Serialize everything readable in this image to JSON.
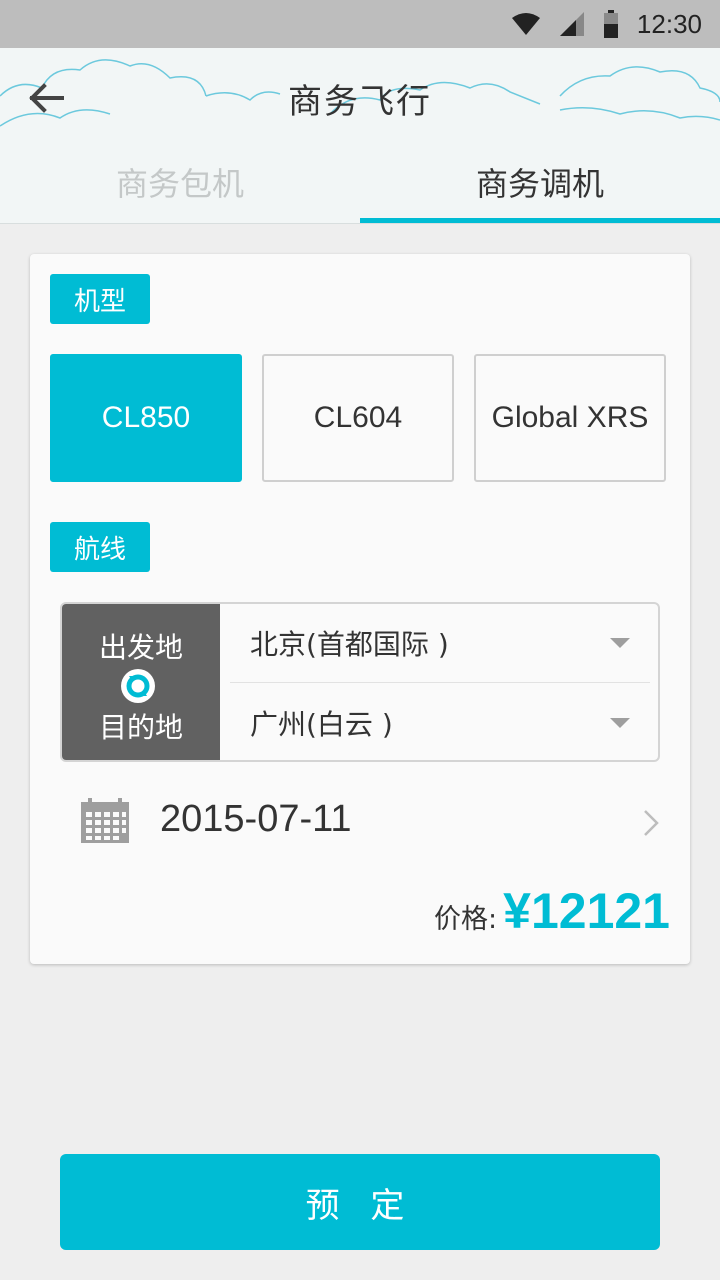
{
  "status_bar": {
    "time": "12:30"
  },
  "header": {
    "title": "商务飞行",
    "tabs": [
      {
        "label": "商务包机",
        "active": false
      },
      {
        "label": "商务调机",
        "active": true
      }
    ]
  },
  "aircraft": {
    "section_label": "机型",
    "options": [
      {
        "label": "CL850",
        "selected": true
      },
      {
        "label": "CL604",
        "selected": false
      },
      {
        "label": "Global XRS",
        "selected": false
      }
    ]
  },
  "route": {
    "section_label": "航线",
    "from_label": "出发地",
    "to_label": "目的地",
    "from_value": "北京(首都国际 )",
    "to_value": "广州(白云 )"
  },
  "date": {
    "value": "2015-07-11"
  },
  "price": {
    "label": "价格:",
    "value": "¥12121"
  },
  "book_button": {
    "label": "预 定"
  },
  "colors": {
    "accent": "#00bcd4",
    "route_side": "#616161",
    "status_bar": "#bdbdbd"
  }
}
